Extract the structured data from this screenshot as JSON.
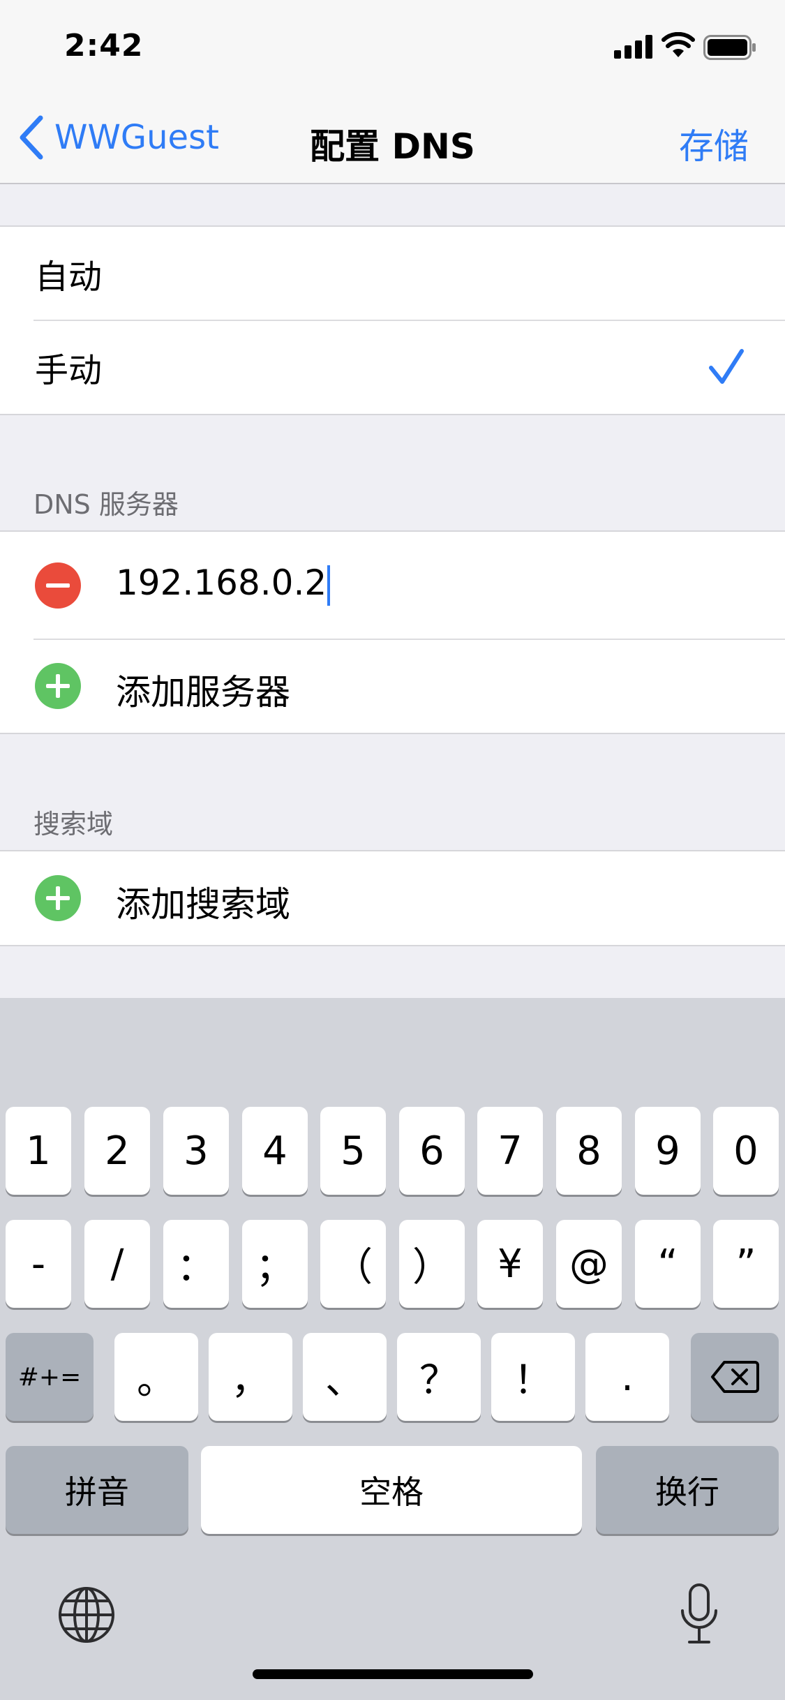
{
  "status_bar": {
    "time": "2:42"
  },
  "nav": {
    "back_label": "WWGuest",
    "title": "配置 DNS",
    "save_label": "存储"
  },
  "mode": {
    "options": [
      "自动",
      "手动"
    ],
    "selected": "手动"
  },
  "dns_servers": {
    "header": "DNS 服务器",
    "entry_value": "192.168.0.2",
    "add_label": "添加服务器"
  },
  "search_domains": {
    "header": "搜索域",
    "add_label": "添加搜索域"
  },
  "keyboard": {
    "row1": [
      "1",
      "2",
      "3",
      "4",
      "5",
      "6",
      "7",
      "8",
      "9",
      "0"
    ],
    "row2": [
      "-",
      "/",
      "：",
      "；",
      "（",
      "）",
      "¥",
      "@",
      "“",
      "”"
    ],
    "row3_left": "#+=",
    "row3": [
      "。",
      "，",
      "、",
      "？",
      "！",
      "."
    ],
    "pinyin": "拼音",
    "space": "空格",
    "return": "换行"
  },
  "colors": {
    "accent": "#2f7cf6",
    "delete": "#ea4b3b",
    "add": "#5fc463"
  }
}
